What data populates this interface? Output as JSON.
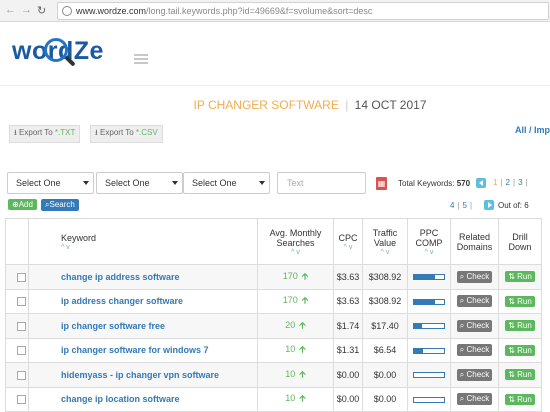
{
  "browser": {
    "url_domain": "www.wordze.com",
    "url_path": "/long.tail.keywords.php?id=49669&f=svolume&sort=desc"
  },
  "header": {
    "logo_left": "w",
    "logo_o": "o",
    "logo_right": "rdZe"
  },
  "title": {
    "name": "IP CHANGER SOFTWARE",
    "separator": "|",
    "date": "14 OCT 2017"
  },
  "exports": {
    "txt_label": "Export To ",
    "txt_ext": "*.TXT",
    "csv_label": "Export To ",
    "csv_ext": "*.CSV",
    "all_import": "All / Impo"
  },
  "filters": {
    "select1": "Select One",
    "select2": "Select One",
    "select3": "Select One",
    "text_placeholder": "Text",
    "pdf_icon": "pdf-icon"
  },
  "summary": {
    "total_label": "Total Keywords:",
    "total_value": "570",
    "page_current": "1",
    "page_2": "2",
    "page_3": "3",
    "page_4": "4",
    "page_5": "5",
    "out_of": "Out of: 6"
  },
  "buttons": {
    "add": "Add",
    "search": "Search"
  },
  "table": {
    "headers": {
      "keyword": "Keyword",
      "avg_line1": "Avg. Monthly",
      "avg_line2": "Searches",
      "cpc": "CPC",
      "traffic_line1": "Traffic",
      "traffic_line2": "Value",
      "ppc_line1": "PPC",
      "ppc_line2": "COMP",
      "related_line1": "Related",
      "related_line2": "Domains",
      "drill_line1": "Drill",
      "drill_line2": "Down",
      "sort_arrows": "^ v"
    },
    "check_label": "Check",
    "run_label": "Run",
    "rows": [
      {
        "keyword": "change ip address software",
        "searches": "170",
        "cpc": "$3.63",
        "traffic": "$308.92",
        "ppc_comp": 0.7
      },
      {
        "keyword": "ip address changer software",
        "searches": "170",
        "cpc": "$3.63",
        "traffic": "$308.92",
        "ppc_comp": 0.7
      },
      {
        "keyword": "ip changer software free",
        "searches": "20",
        "cpc": "$1.74",
        "traffic": "$17.40",
        "ppc_comp": 0.25
      },
      {
        "keyword": "ip changer software for windows 7",
        "searches": "10",
        "cpc": "$1.31",
        "traffic": "$6.54",
        "ppc_comp": 0.3
      },
      {
        "keyword": "hidemyass - ip changer vpn software",
        "searches": "10",
        "cpc": "$0.00",
        "traffic": "$0.00",
        "ppc_comp": 0.0
      },
      {
        "keyword": "change ip location software",
        "searches": "10",
        "cpc": "$0.00",
        "traffic": "$0.00",
        "ppc_comp": 0.0
      }
    ]
  },
  "colors": {
    "accent_orange": "#f0ad4e",
    "link_blue": "#337ab7",
    "green": "#5cb85c",
    "info_blue": "#5bc0de"
  }
}
